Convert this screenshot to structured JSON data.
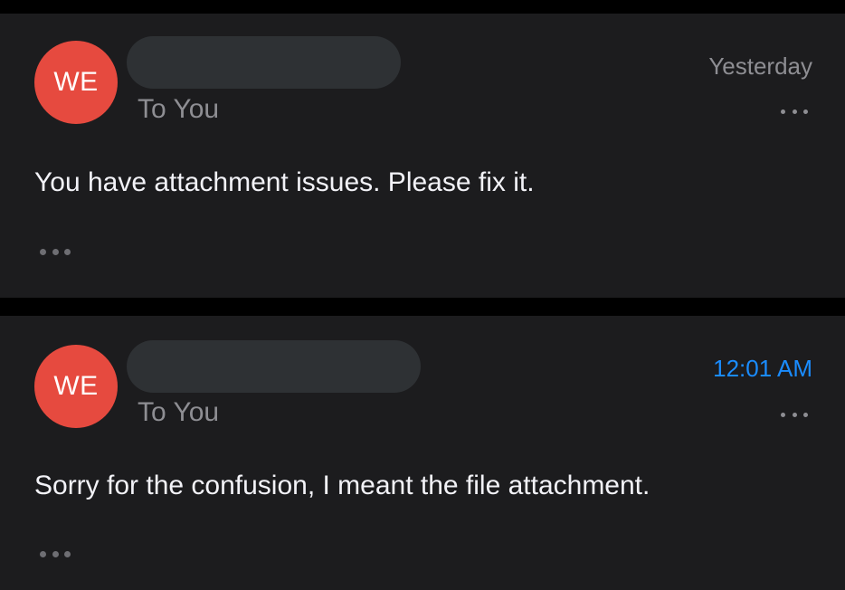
{
  "messages": [
    {
      "avatar_initials": "WE",
      "avatar_color": "#e64a3f",
      "recipient": "To You",
      "timestamp": "Yesterday",
      "timestamp_color": "#8e8e93",
      "body": "You have attachment issues. Please fix it.",
      "more_icon": "ellipsis-icon",
      "expand_icon": "ellipsis-icon"
    },
    {
      "avatar_initials": "WE",
      "avatar_color": "#e64a3f",
      "recipient": "To You",
      "timestamp": "12:01 AM",
      "timestamp_color": "#1a8cff",
      "body": "Sorry for the confusion, I meant the file attachment.",
      "more_icon": "ellipsis-icon",
      "expand_icon": "ellipsis-icon"
    }
  ]
}
